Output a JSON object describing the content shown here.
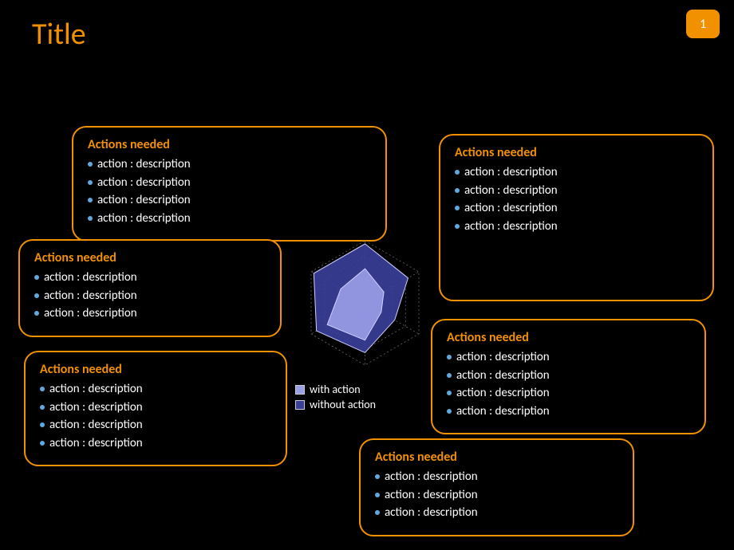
{
  "title": "Title",
  "page_number": "1",
  "cards": [
    {
      "heading": "Actions needed",
      "items": [
        "action :  description",
        "action :  description",
        "action :  description",
        "action :  description"
      ]
    },
    {
      "heading": "Actions needed",
      "items": [
        "action :  description",
        "action :  description",
        "action :  description"
      ]
    },
    {
      "heading": "Actions needed",
      "items": [
        "action :  description",
        "action :  description",
        "action :  description",
        "action :  description"
      ]
    },
    {
      "heading": "Actions needed",
      "items": [
        "action : description",
        "action :  description",
        "action :  description",
        "action :  description"
      ]
    },
    {
      "heading": "Actions needed",
      "items": [
        "action :  description",
        "action :  description",
        "action :  description",
        "action :  description"
      ]
    },
    {
      "heading": "Actions needed",
      "items": [
        "action :  description",
        "action :  description",
        "action :  description"
      ]
    }
  ],
  "legend": {
    "with": {
      "label": "with action",
      "color": "#9b9fe8"
    },
    "without": {
      "label": "without action",
      "color": "#3b3f9a"
    }
  },
  "chart_data": {
    "type": "radar",
    "title": "",
    "axes_count": 6,
    "rlim": [
      0,
      1
    ],
    "grid_rings": 4,
    "series": [
      {
        "name": "without action",
        "color": "#3b3f9a",
        "values": [
          0.95,
          0.8,
          0.55,
          0.8,
          0.9,
          0.95
        ]
      },
      {
        "name": "with action",
        "color": "#9b9fe8",
        "values": [
          0.55,
          0.35,
          0.3,
          0.6,
          0.7,
          0.45
        ]
      }
    ],
    "legend_position": "bottom"
  }
}
